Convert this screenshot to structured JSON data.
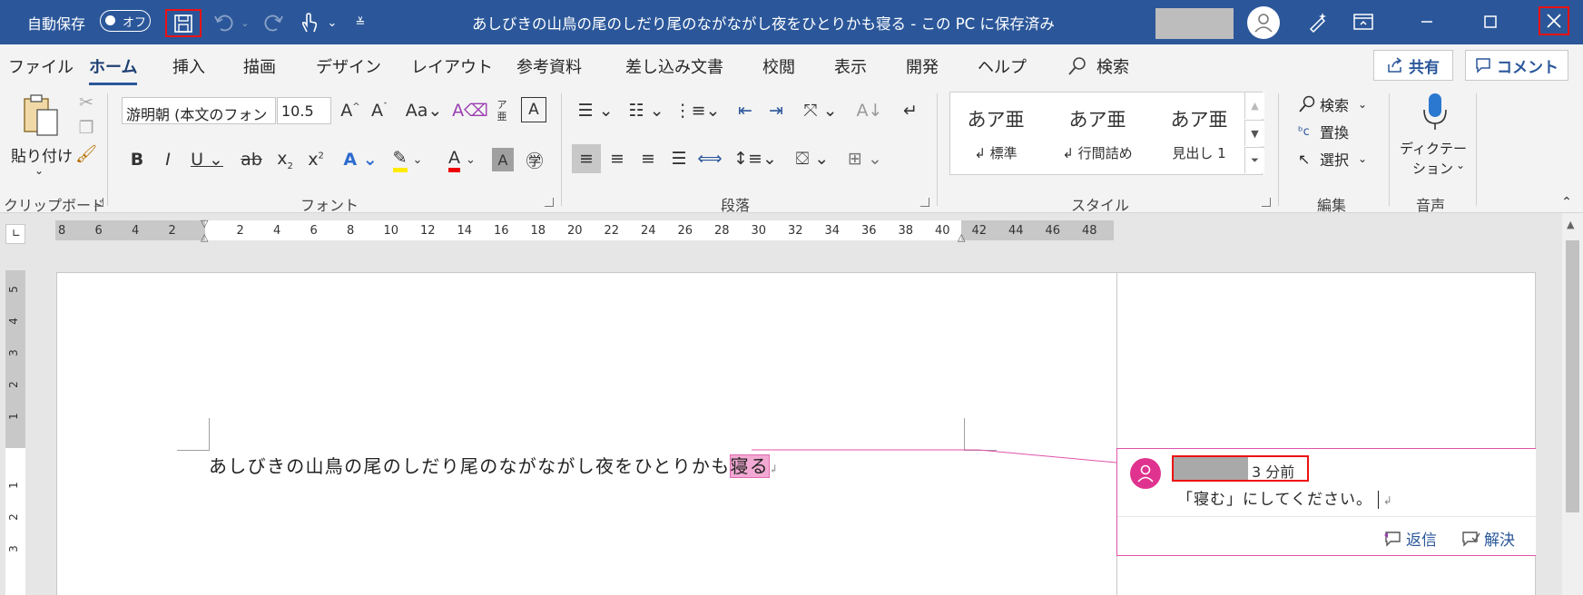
{
  "titlebar": {
    "autosave_label": "自動保存",
    "autosave_state": "オフ",
    "title": "あしびきの山鳥の尾のしだり尾のながながし夜をひとりかも寝る - この PC に保存済み"
  },
  "menu": {
    "tabs": [
      "ファイル",
      "ホーム",
      "挿入",
      "描画",
      "デザイン",
      "レイアウト",
      "参考資料",
      "差し込み文書",
      "校閲",
      "表示",
      "開発",
      "ヘルプ"
    ],
    "active": "ホーム",
    "search_label": "検索",
    "share_label": "共有",
    "comment_label": "コメント"
  },
  "ribbon": {
    "clipboard": {
      "paste_label": "貼り付け",
      "group_label": "クリップボード"
    },
    "font": {
      "font_name": "游明朝 (本文のフォン",
      "font_size": "10.5",
      "group_label": "フォント",
      "furigana_top": "ア",
      "furigana_bottom": "亜"
    },
    "paragraph": {
      "group_label": "段落"
    },
    "styles": {
      "items": [
        {
          "sample": "あア亜",
          "name": "↲ 標準"
        },
        {
          "sample": "あア亜",
          "name": "↲ 行間詰め"
        },
        {
          "sample": "あア亜",
          "name": "見出し 1"
        }
      ],
      "group_label": "スタイル"
    },
    "editing": {
      "find": "検索",
      "replace": "置換",
      "select": "選択",
      "group_label": "編集"
    },
    "voice": {
      "dictation_line1": "ディクテー",
      "dictation_line2": "ション",
      "group_label": "音声"
    }
  },
  "ruler": {
    "left_numbers": [
      "8",
      "6",
      "4",
      "2"
    ],
    "right_numbers": [
      "2",
      "4",
      "6",
      "8",
      "10",
      "12",
      "14",
      "16",
      "18",
      "20",
      "22",
      "24",
      "26",
      "28",
      "30",
      "32",
      "34",
      "36",
      "38",
      "40",
      "42",
      "44",
      "46",
      "48"
    ],
    "vertical_top": [
      "5",
      "4",
      "3",
      "2",
      "1"
    ],
    "vertical_bottom": [
      "1",
      "2",
      "3"
    ]
  },
  "document": {
    "text_before": "あしびきの山鳥の尾のしだり尾のながながし夜をひとりかも",
    "text_highlight": "寝る"
  },
  "comment": {
    "time": "3 分前",
    "body": "「寝む」にしてください。",
    "reply": "返信",
    "resolve": "解決"
  },
  "colors": {
    "accent": "#2b579a",
    "highlight_box": "#ee1111",
    "comment_border": "#e052a9",
    "comment_avatar": "#e0338f"
  }
}
